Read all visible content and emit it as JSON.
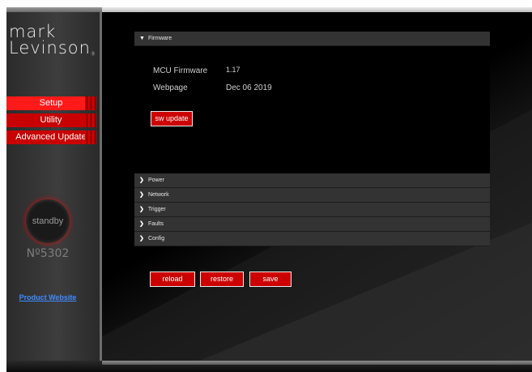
{
  "logo": {
    "line1": "mark",
    "line2": "Levinson",
    "mark": "®"
  },
  "nav": {
    "items": [
      {
        "label": "Setup",
        "active": true
      },
      {
        "label": "Utility",
        "active": false
      },
      {
        "label": "Advanced Update",
        "active": false
      }
    ]
  },
  "standby": {
    "label": "standby"
  },
  "model": {
    "number": "Nº5302"
  },
  "product_link": {
    "label": "Product Website"
  },
  "firmware": {
    "title": "Firmware",
    "rows": [
      {
        "label": "MCU Firmware",
        "value": "1.17"
      },
      {
        "label": "Webpage",
        "value": "Dec 06 2019"
      }
    ],
    "sw_update_label": "sw update"
  },
  "sections": [
    {
      "title": "Power"
    },
    {
      "title": "Network"
    },
    {
      "title": "Trigger"
    },
    {
      "title": "Faults"
    },
    {
      "title": "Config"
    }
  ],
  "actions": {
    "reload_label": "reload",
    "restore_label": "restore",
    "save_label": "save"
  },
  "colors": {
    "accent": "#cc0000",
    "header_bar": "#333333",
    "link": "#3e8cff"
  }
}
